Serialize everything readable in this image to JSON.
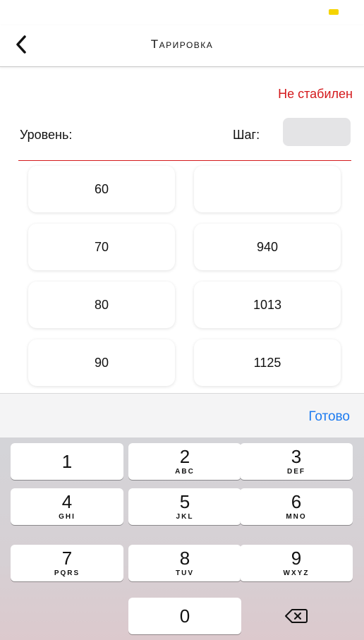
{
  "nav": {
    "title": "Тарировка"
  },
  "status": {
    "text": "Не стабилен",
    "color": "#d4191c"
  },
  "form": {
    "level_label": "Уровень:",
    "step_label": "Шаг:",
    "step_value": ""
  },
  "table": {
    "rows": [
      {
        "left": "60",
        "right": ""
      },
      {
        "left": "70",
        "right": "940"
      },
      {
        "left": "80",
        "right": "1013"
      },
      {
        "left": "90",
        "right": "1125"
      }
    ]
  },
  "keyboard": {
    "done_label": "Готово",
    "done_color": "#1d7bf0",
    "keys": [
      {
        "digit": "1",
        "letters": ""
      },
      {
        "digit": "2",
        "letters": "ABC"
      },
      {
        "digit": "3",
        "letters": "DEF"
      },
      {
        "digit": "4",
        "letters": "GHI"
      },
      {
        "digit": "5",
        "letters": "JKL"
      },
      {
        "digit": "6",
        "letters": "MNO"
      },
      {
        "digit": "7",
        "letters": "PQRS"
      },
      {
        "digit": "8",
        "letters": "TUV"
      },
      {
        "digit": "9",
        "letters": "WXYZ"
      },
      {
        "digit": "0",
        "letters": ""
      }
    ],
    "delete_icon": "backspace-icon"
  },
  "accent_colors": {
    "battery_indicator": "#f5d400"
  }
}
